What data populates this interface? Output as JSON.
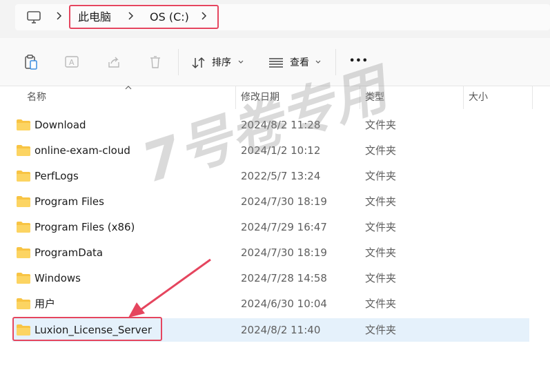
{
  "address": {
    "crumbs": [
      "此电脑",
      "OS (C:)"
    ]
  },
  "toolbar": {
    "sort_label": "排序",
    "view_label": "查看",
    "more_label": "•••"
  },
  "columns": {
    "name": "名称",
    "date": "修改日期",
    "type": "类型",
    "size": "大小"
  },
  "rows": [
    {
      "name": "Download",
      "date": "2024/8/2 11:28",
      "type": "文件夹"
    },
    {
      "name": "online-exam-cloud",
      "date": "2024/1/2 10:12",
      "type": "文件夹"
    },
    {
      "name": "PerfLogs",
      "date": "2022/5/7 13:24",
      "type": "文件夹"
    },
    {
      "name": "Program Files",
      "date": "2024/7/30 18:19",
      "type": "文件夹"
    },
    {
      "name": "Program Files (x86)",
      "date": "2024/7/29 16:47",
      "type": "文件夹"
    },
    {
      "name": "ProgramData",
      "date": "2024/7/30 18:19",
      "type": "文件夹"
    },
    {
      "name": "Windows",
      "date": "2024/7/28 14:58",
      "type": "文件夹"
    },
    {
      "name": "用户",
      "date": "2024/6/30 10:04",
      "type": "文件夹"
    },
    {
      "name": "Luxion_License_Server",
      "date": "2024/8/2 11:40",
      "type": "文件夹"
    }
  ],
  "watermark": "7号卷专用",
  "colors": {
    "folder": "#f8c444",
    "highlight": "#e5455e",
    "selected_row": "#e5f1fb"
  }
}
